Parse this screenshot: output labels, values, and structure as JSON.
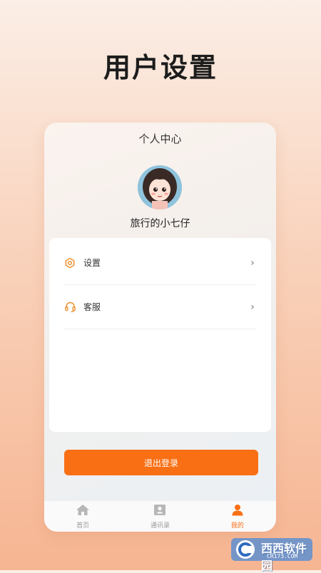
{
  "page": {
    "headline": "用户设置"
  },
  "profile": {
    "title": "个人中心",
    "username": "旅行的小七仔"
  },
  "menu": [
    {
      "label": "设置",
      "icon": "gear-icon"
    },
    {
      "label": "客服",
      "icon": "headset-icon"
    }
  ],
  "logout_label": "退出登录",
  "tabs": [
    {
      "label": "首页",
      "icon": "home-icon",
      "active": false
    },
    {
      "label": "通讯录",
      "icon": "contacts-icon",
      "active": false
    },
    {
      "label": "我的",
      "icon": "user-icon",
      "active": true
    }
  ],
  "watermark": {
    "text": "西西软件园",
    "sub": "CR173.COM"
  },
  "colors": {
    "accent": "#f96f14",
    "background": "#f9d2bb"
  }
}
